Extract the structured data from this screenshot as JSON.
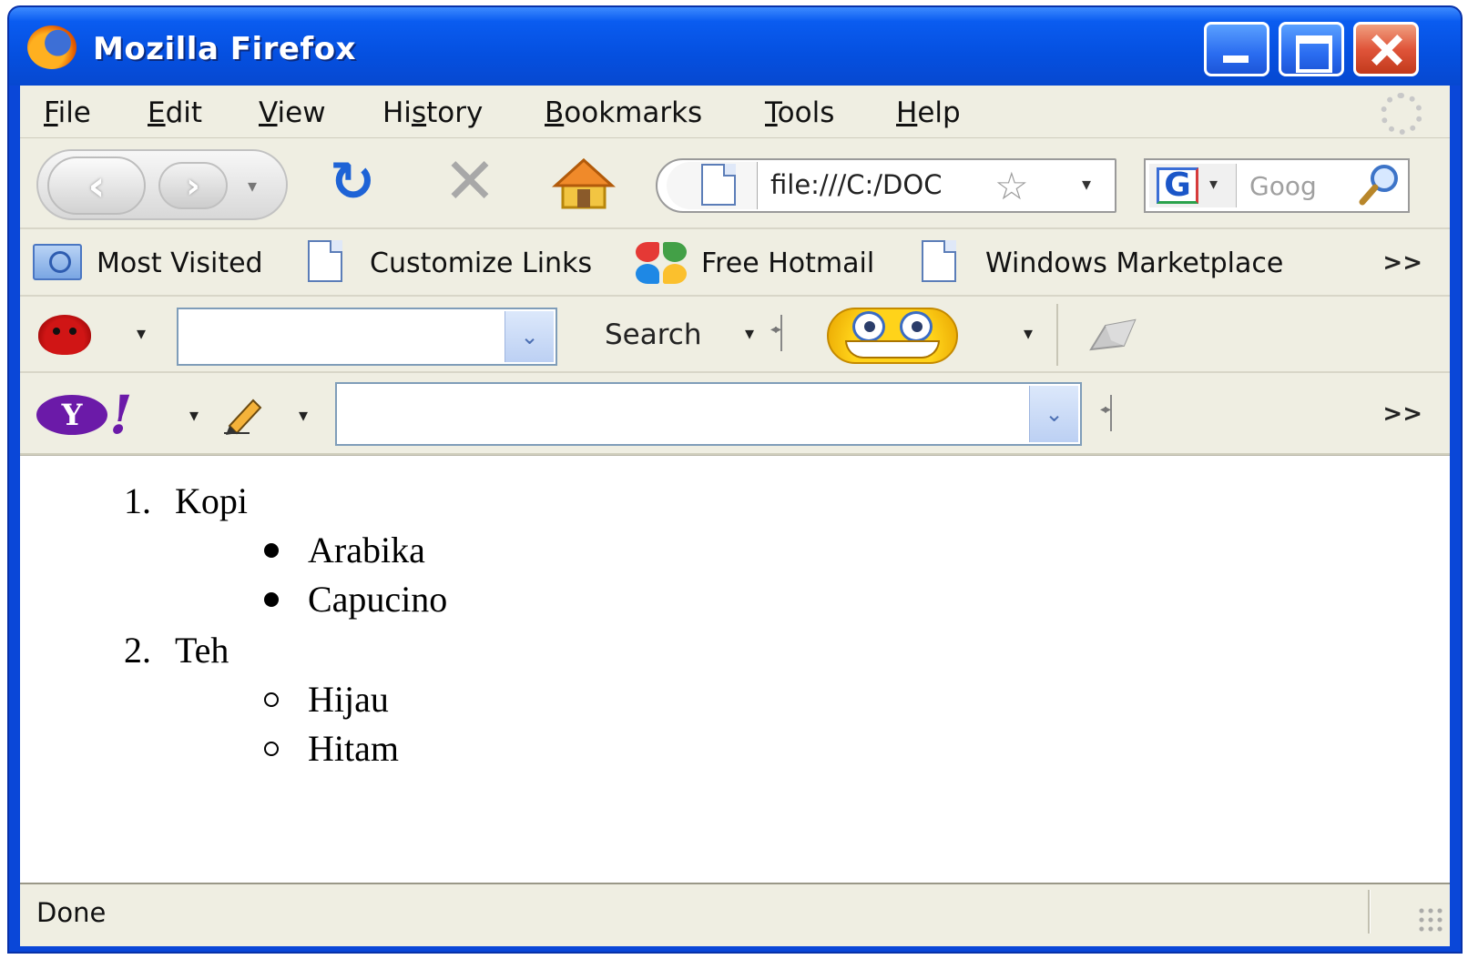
{
  "window": {
    "title": "Mozilla Firefox",
    "controls": [
      "minimize",
      "maximize",
      "close"
    ]
  },
  "menubar": {
    "items": [
      {
        "label": "File",
        "accel": "F"
      },
      {
        "label": "Edit",
        "accel": "E"
      },
      {
        "label": "View",
        "accel": "V"
      },
      {
        "label": "History",
        "accel": "s"
      },
      {
        "label": "Bookmarks",
        "accel": "B"
      },
      {
        "label": "Tools",
        "accel": "T"
      },
      {
        "label": "Help",
        "accel": "H"
      }
    ]
  },
  "navbar": {
    "url": "file:///C:/DOC",
    "search_engine_icon": "google-icon",
    "search_placeholder": "Goog"
  },
  "bookmarks": {
    "items": [
      {
        "label": "Most Visited",
        "icon": "folder-icon"
      },
      {
        "label": "Customize Links",
        "icon": "page-icon"
      },
      {
        "label": "Free Hotmail",
        "icon": "msn-icon"
      },
      {
        "label": "Windows Marketplace",
        "icon": "page-icon"
      }
    ],
    "overflow": ">>"
  },
  "toolbar1": {
    "search_label": "Search",
    "search_value": ""
  },
  "toolbar2": {
    "search_value": "",
    "overflow": ">>"
  },
  "content": {
    "list": [
      {
        "number": "1.",
        "text": "Kopi",
        "bullet": "disc",
        "children": [
          "Arabika",
          "Capucino"
        ]
      },
      {
        "number": "2.",
        "text": "Teh",
        "bullet": "circle",
        "children": [
          "Hijau",
          "Hitam"
        ]
      }
    ]
  },
  "status": {
    "text": "Done"
  },
  "colors": {
    "titlebar": "#0550e0",
    "chrome": "#efeee2",
    "yahoo_purple": "#6b1aa8"
  }
}
